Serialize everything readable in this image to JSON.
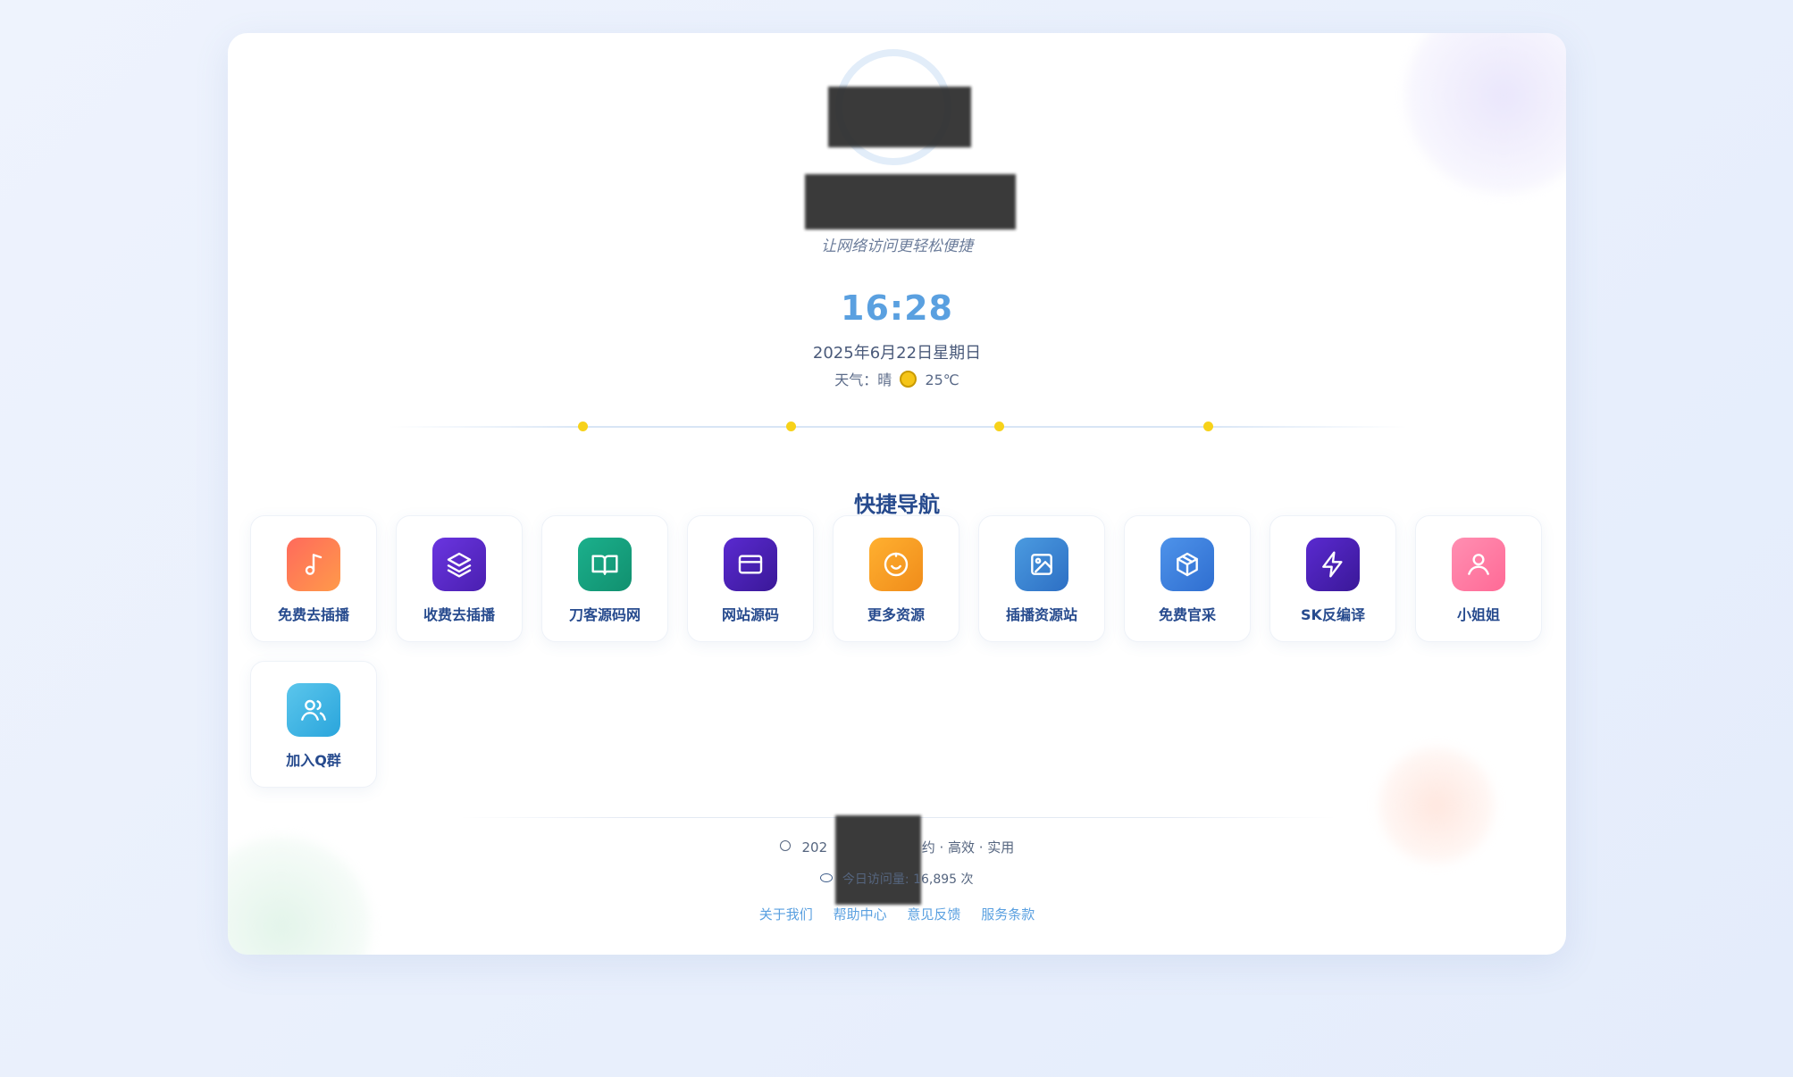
{
  "header": {
    "tagline": "让网络访问更轻松便捷"
  },
  "clock": {
    "time": "16:28",
    "date": "2025年6月22日星期日",
    "weather_label": "天气：晴",
    "temperature": "25℃"
  },
  "nav": {
    "title": "快捷导航",
    "items": [
      {
        "label": "免费去插播",
        "icon": "music-note-icon",
        "color": "#ff7a59"
      },
      {
        "label": "收费去插播",
        "icon": "layers-icon",
        "color": "#5b2bd1"
      },
      {
        "label": "刀客源码网",
        "icon": "book-open-icon",
        "color": "#17a383"
      },
      {
        "label": "网站源码",
        "icon": "credit-card-icon",
        "color": "#4b22b8"
      },
      {
        "label": "更多资源",
        "icon": "clock-icon",
        "color": "#f8a22a"
      },
      {
        "label": "插播资源站",
        "icon": "image-icon",
        "color": "#3f86d6"
      },
      {
        "label": "免费官采",
        "icon": "package-icon",
        "color": "#3d7fe0"
      },
      {
        "label": "SK反编译",
        "icon": "lightning-icon",
        "color": "#4d22b6"
      },
      {
        "label": "小姐姐",
        "icon": "user-icon",
        "color": "#ff7aa2"
      },
      {
        "label": "加入Q群",
        "icon": "users-icon",
        "color": "#36b2e6"
      }
    ]
  },
  "footer": {
    "copyright_prefix": "202",
    "copyright_suffix": "约 · 高效 · 实用",
    "visits": "今日访问量: 16,895 次",
    "links": [
      "关于我们",
      "帮助中心",
      "意见反馈",
      "服务条款"
    ]
  }
}
